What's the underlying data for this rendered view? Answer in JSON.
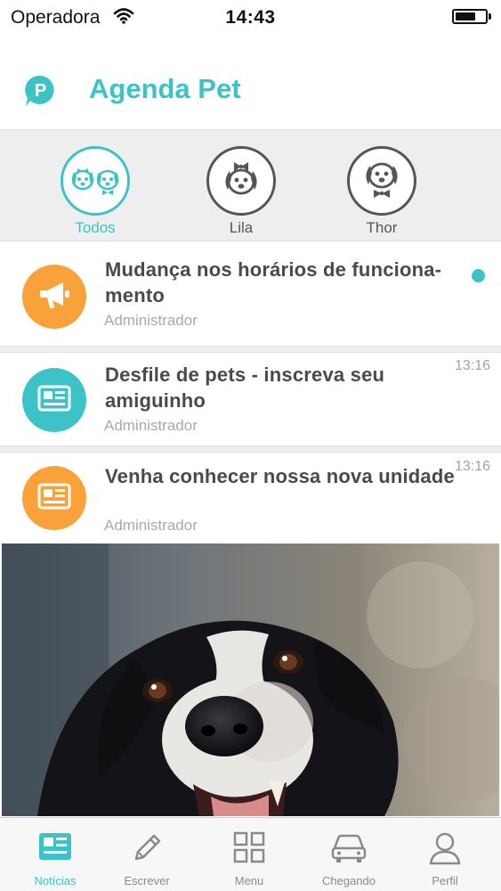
{
  "status_bar": {
    "carrier": "Operadora",
    "time": "14:43",
    "battery_level": 0.7
  },
  "header": {
    "logo_letter": "P",
    "title": "Agenda Pet"
  },
  "pets": [
    {
      "label": "Todos",
      "icon": "two-dogs-icon",
      "active": true
    },
    {
      "label": "Lila",
      "icon": "dog-with-bow-icon",
      "active": false
    },
    {
      "label": "Thor",
      "icon": "dog-with-bowtie-icon",
      "active": false
    }
  ],
  "news": [
    {
      "title": "Mudança nos horários de funciona-mento",
      "author": "Administrador",
      "time": "",
      "icon": "megaphone-icon",
      "unread": true
    },
    {
      "title": "Desfile de pets - inscreva seu amiguinho",
      "author": "Administrador",
      "time": "13:16",
      "icon": "newspaper-icon",
      "unread": false
    },
    {
      "title": "Venha conhecer nossa nova unidade",
      "author": "Administrador",
      "time": "13:16",
      "icon": "newspaper-icon",
      "unread": false
    }
  ],
  "tabs": [
    {
      "label": "Notícias",
      "icon": "news-icon",
      "active": true
    },
    {
      "label": "Escrever",
      "icon": "pencil-icon",
      "active": false
    },
    {
      "label": "Menu",
      "icon": "grid-icon",
      "active": false
    },
    {
      "label": "Chegando",
      "icon": "car-icon",
      "active": false
    },
    {
      "label": "Perfil",
      "icon": "user-icon",
      "active": false
    }
  ],
  "colors": {
    "accent": "#3cc3c8",
    "orange": "#f9a23a",
    "text": "#4a4a4a",
    "muted": "#a9a9a9"
  }
}
